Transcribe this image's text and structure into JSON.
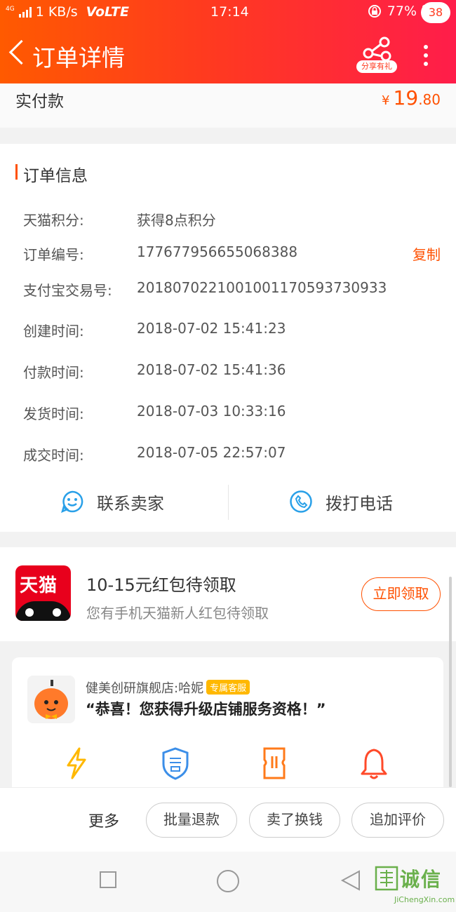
{
  "status_bar": {
    "network": "4G",
    "speed": "1 KB/s",
    "volte": "VoLTE",
    "time": "17:14",
    "battery": "77%",
    "battery_level": 0.77
  },
  "header": {
    "title": "订单详情",
    "share_label": "分享有礼",
    "badge": "38"
  },
  "payment": {
    "label": "实付款",
    "currency": "¥",
    "amount_int": "19",
    "amount_dec": ".80"
  },
  "order_info": {
    "title": "订单信息",
    "rows": [
      {
        "label": "天猫积分:",
        "value": "获得8点积分"
      },
      {
        "label": "订单编号:",
        "value": "177677956655068388",
        "action": "复制"
      },
      {
        "label": "支付宝交易号:",
        "value": "2018070221001001170593730933"
      },
      {
        "label": "创建时间:",
        "value": "2018-07-02 15:41:23"
      },
      {
        "label": "付款时间:",
        "value": "2018-07-02 15:41:36"
      },
      {
        "label": "发货时间:",
        "value": "2018-07-03 10:33:16"
      },
      {
        "label": "成交时间:",
        "value": "2018-07-05 22:57:07"
      }
    ],
    "contact_seller": "联系卖家",
    "call_phone": "拨打电话"
  },
  "promo": {
    "logo_text": "天猫",
    "title": "10-15元红包待领取",
    "subtitle": "您有手机天猫新人红包待领取",
    "button": "立即领取"
  },
  "store": {
    "name": "健美创研旗舰店:哈妮",
    "tag": "专属客服",
    "message": "“恭喜！您获得升级店铺服务资格！”",
    "services": [
      {
        "icon": "lightning-icon",
        "color": "#ffb800"
      },
      {
        "icon": "after-sale-shield-icon",
        "color": "#3b8ee8"
      },
      {
        "icon": "coupon-ticket-icon",
        "color": "#ff7a1a"
      },
      {
        "icon": "bell-icon",
        "color": "#ff4a2a"
      }
    ]
  },
  "bottom_bar": {
    "more": "更多",
    "buttons": [
      "批量退款",
      "卖了换钱",
      "追加评价"
    ]
  },
  "watermark": {
    "text": "诚信",
    "sub": "JiChengXin.com"
  },
  "colors": {
    "accent": "#ff5000",
    "header_start": "#ff5a00",
    "header_end": "#ff1d4a",
    "icon_blue": "#29a0e8"
  }
}
